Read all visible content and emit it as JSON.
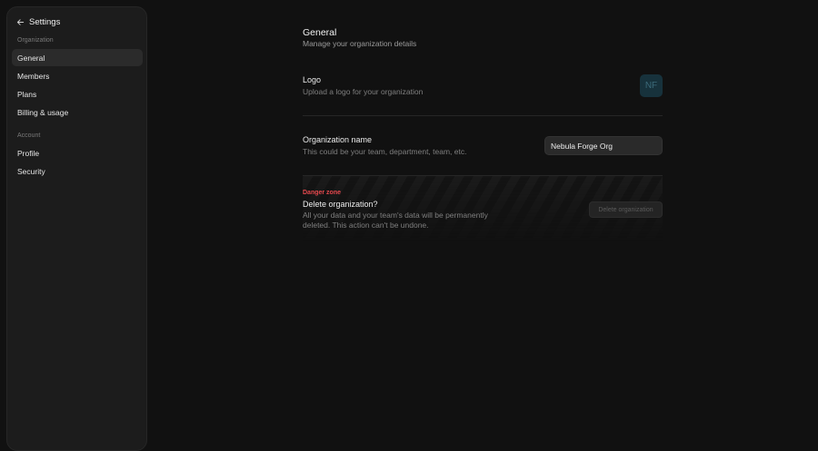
{
  "sidebar": {
    "back_label": "Settings",
    "sections": [
      {
        "label": "Organization",
        "items": [
          {
            "label": "General",
            "active": true
          },
          {
            "label": "Members"
          },
          {
            "label": "Plans"
          },
          {
            "label": "Billing & usage"
          }
        ]
      },
      {
        "label": "Account",
        "items": [
          {
            "label": "Profile"
          },
          {
            "label": "Security"
          }
        ]
      }
    ]
  },
  "main": {
    "title": "General",
    "subtitle": "Manage your organization details",
    "logo": {
      "title": "Logo",
      "description": "Upload a logo for your organization",
      "initials": "NF"
    },
    "org_name": {
      "title": "Organization name",
      "description": "This could be your team, department, team, etc.",
      "value": "Nebula Forge Org"
    },
    "danger": {
      "label": "Danger zone",
      "title": "Delete organization?",
      "description": "All your data and your team's data will be permanently deleted. This action can't be undone.",
      "button_label": "Delete organization"
    }
  },
  "colors": {
    "background": "#111111",
    "sidebar": "#1c1c1c",
    "active_item": "#2b2b2b",
    "danger": "#e5484d",
    "logo_badge": "#17323c"
  }
}
